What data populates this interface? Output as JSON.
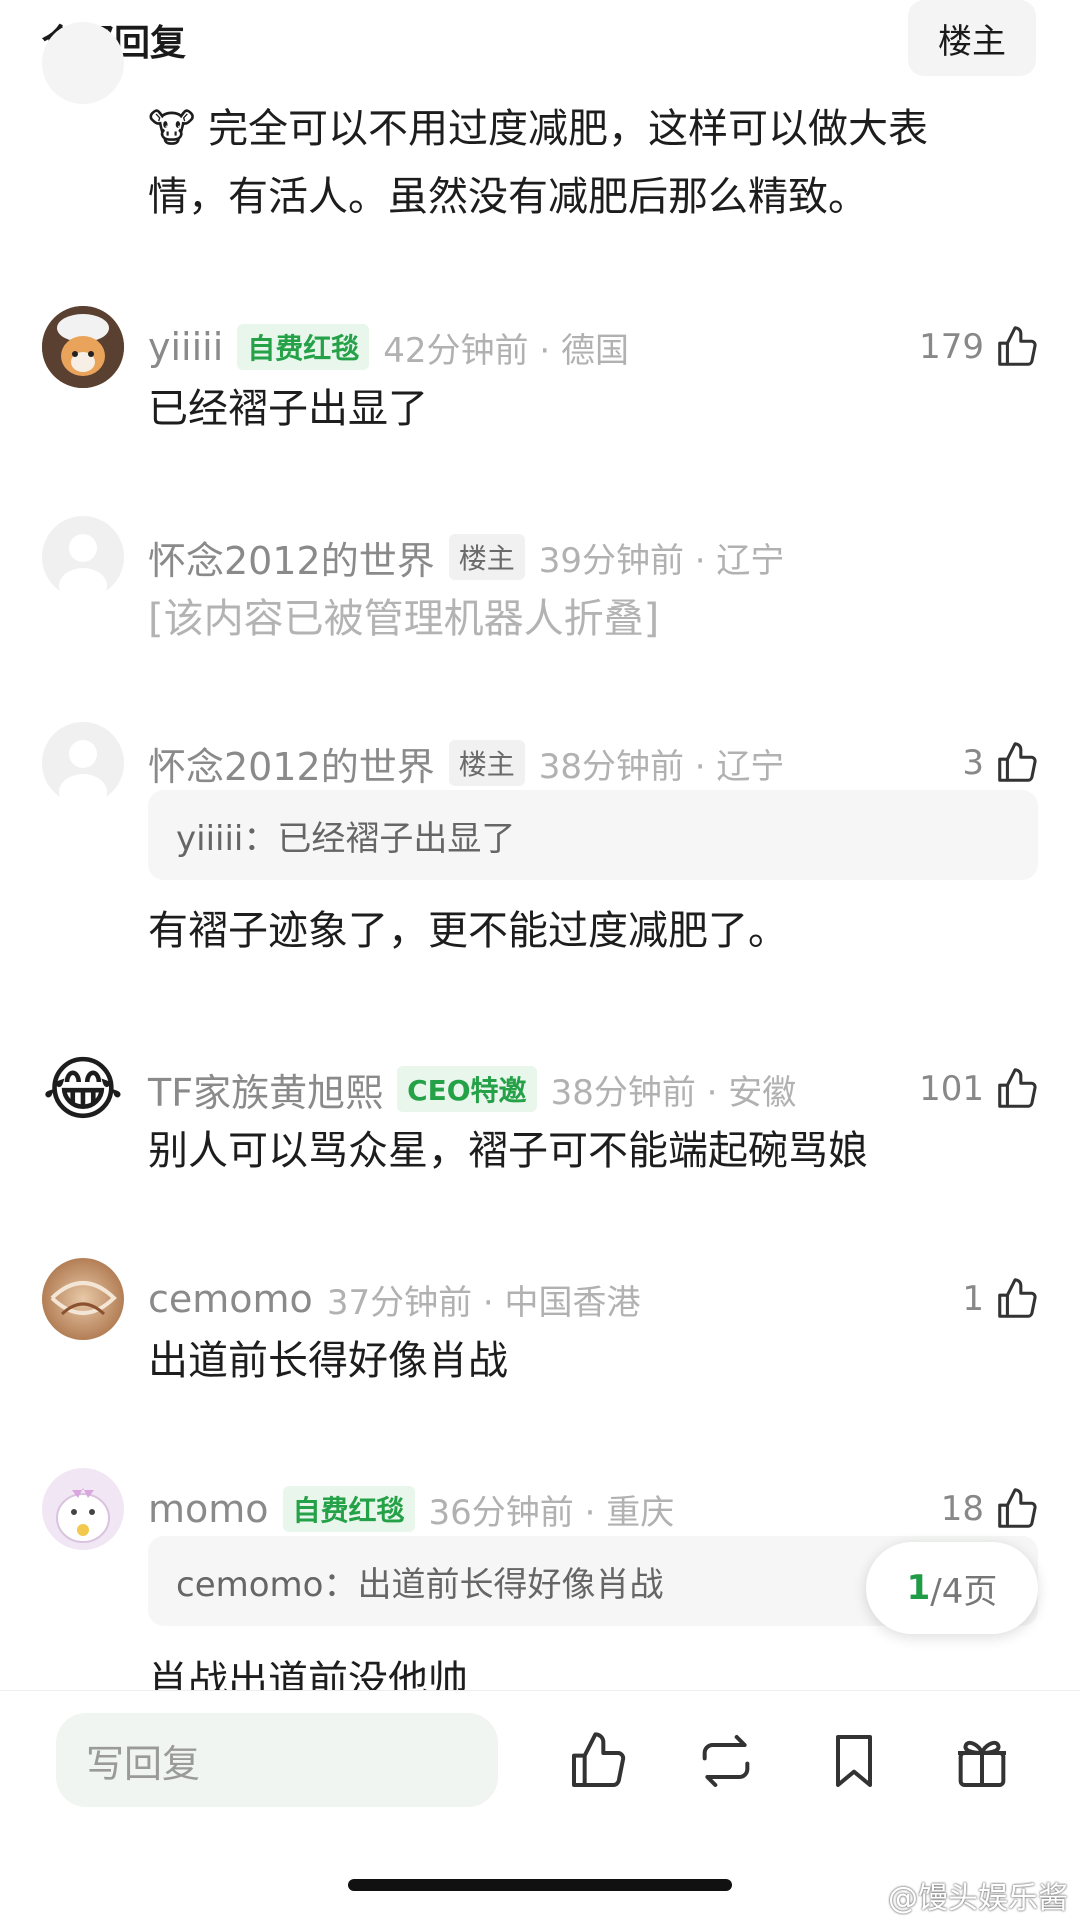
{
  "header": {
    "title": "全部回复",
    "louzhu_button": "楼主"
  },
  "comments": [
    {
      "text": "完全可以不用过度减肥，这样可以做大表",
      "text2": "情，有活人。虽然没有减肥后那么精致。",
      "emoji": "🐮"
    },
    {
      "nick": "yiiiii",
      "badge": "自费红毯",
      "time": "42分钟前 · 德国",
      "likes": "179",
      "text": "已经褶子出显了"
    },
    {
      "nick": "怀念2012的世界",
      "badge": "楼主",
      "time": "39分钟前 · 辽宁",
      "text": "[该内容已被管理机器人折叠]"
    },
    {
      "nick": "怀念2012的世界",
      "badge": "楼主",
      "time": "38分钟前 · 辽宁",
      "likes": "3",
      "quote": "yiiiii：已经褶子出显了",
      "text": "有褶子迹象了，更不能过度减肥了。"
    },
    {
      "nick": "TF家族黄旭熙",
      "badge": "CEO特邀",
      "time": "38分钟前 · 安徽",
      "likes": "101",
      "text": "别人可以骂众星，褶子可不能端起碗骂娘",
      "avatar_emoji": "😂"
    },
    {
      "nick": "cemomo",
      "time": "37分钟前 · 中国香港",
      "likes": "1",
      "text": "出道前长得好像肖战"
    },
    {
      "nick": "momo",
      "badge": "自费红毯",
      "time": "36分钟前 · 重庆",
      "likes": "18",
      "quote": "cemomo：出道前长得好像肖战",
      "text": "肖战出道前没他帅"
    }
  ],
  "pagination": {
    "current": "1",
    "rest": "/4页"
  },
  "bottom_bar": {
    "reply_placeholder": "写回复",
    "watermark": "@馒头娱乐酱"
  },
  "icons": [
    "thumb-up-icon",
    "repost-icon",
    "bookmark-icon",
    "gift-icon"
  ],
  "colors": {
    "accent_green": "#25a148",
    "text_gray": "#8a8a8a"
  }
}
